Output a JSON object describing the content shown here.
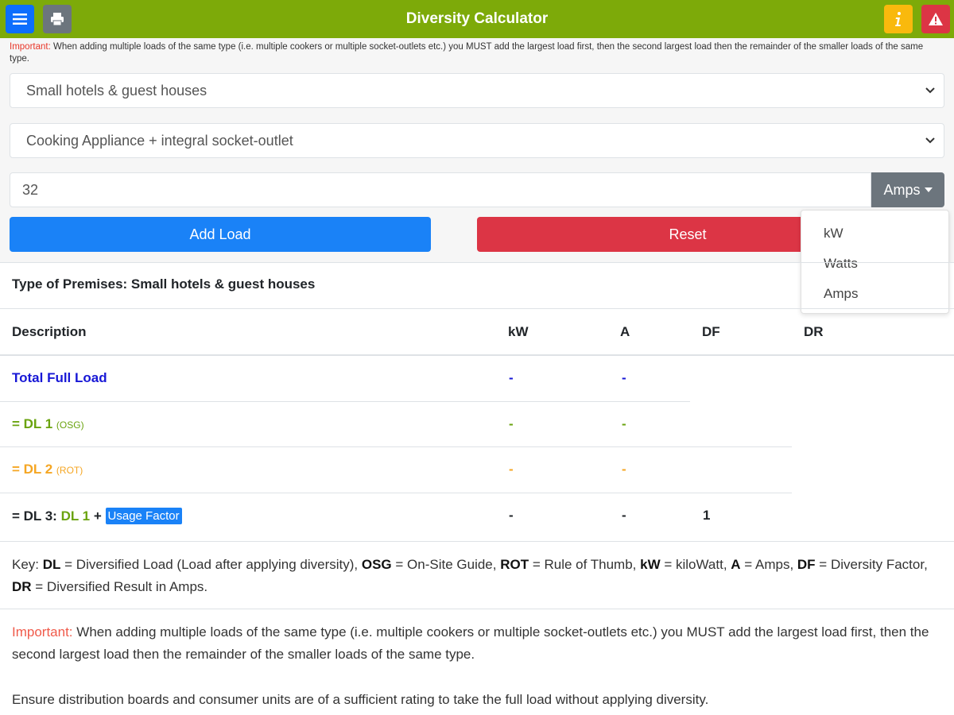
{
  "app": {
    "title": "Diversity Calculator"
  },
  "topbar": {
    "menu_icon": "hamburger-menu-icon",
    "print_icon": "print-icon",
    "info_icon": "info-icon",
    "alert_icon": "warning-triangle-icon",
    "colors": {
      "bar": "#7daa09",
      "menu": "#0d6efd",
      "print": "#6c757d",
      "info": "#f9b90d",
      "alert": "#dc3545"
    }
  },
  "notice_top": {
    "important": "Important:",
    "text": " When adding multiple loads of the same type (i.e. multiple cookers or multiple socket-outlets etc.) you MUST add the largest load first, then the second largest load then the remainder of the smaller loads of the same type."
  },
  "form": {
    "premises_select": "Small hotels & guest houses",
    "appliance_select": "Cooking Appliance + integral socket-outlet",
    "load_value": "32",
    "unit_button": "Amps",
    "add_button": "Add Load",
    "reset_button": "Reset"
  },
  "unit_dropdown": {
    "options": [
      "kW",
      "Watts",
      "Amps"
    ]
  },
  "premises_header": "Type of Premises: Small hotels & guest houses",
  "table": {
    "headers": [
      "Description",
      "kW",
      "A",
      "DF",
      "DR"
    ],
    "rows": [
      {
        "label": "Total Full Load",
        "kw": "-",
        "a": "-",
        "df": ""
      },
      {
        "label": "= DL 1",
        "tag": "(OSG)",
        "kw": "-",
        "a": "-",
        "df": ""
      },
      {
        "label": "= DL 2",
        "tag": "(ROT)",
        "kw": "-",
        "a": "-",
        "df": ""
      },
      {
        "label_prefix": "= DL 3:",
        "label_dl": "DL 1",
        "label_plus": "+",
        "badge": "Usage Factor",
        "kw": "-",
        "a": "-",
        "df": "1"
      }
    ]
  },
  "key": {
    "prefix": "Key: ",
    "dl": "DL",
    "dl_desc": " = Diversified Load (Load after applying diversity), ",
    "osg": "OSG",
    "osg_desc": " = On-Site Guide, ",
    "rot": "ROT",
    "rot_desc": " = Rule of Thumb, ",
    "kw": "kW",
    "kw_desc": " = kiloWatt, ",
    "a": "A",
    "a_desc": " = Amps, ",
    "df": "DF",
    "df_desc": " = Diversity Factor, ",
    "dr": "DR",
    "dr_desc": " = Diversified Result in Amps."
  },
  "note": {
    "important": "Important:",
    "text": " When adding multiple loads of the same type (i.e. multiple cookers or multiple socket-outlets etc.) you MUST add the largest load first, then the second largest load then the remainder of the smaller loads of the same type."
  },
  "ensure": "Ensure distribution boards and consumer units are of a sufficient rating to take the full load without applying diversity."
}
